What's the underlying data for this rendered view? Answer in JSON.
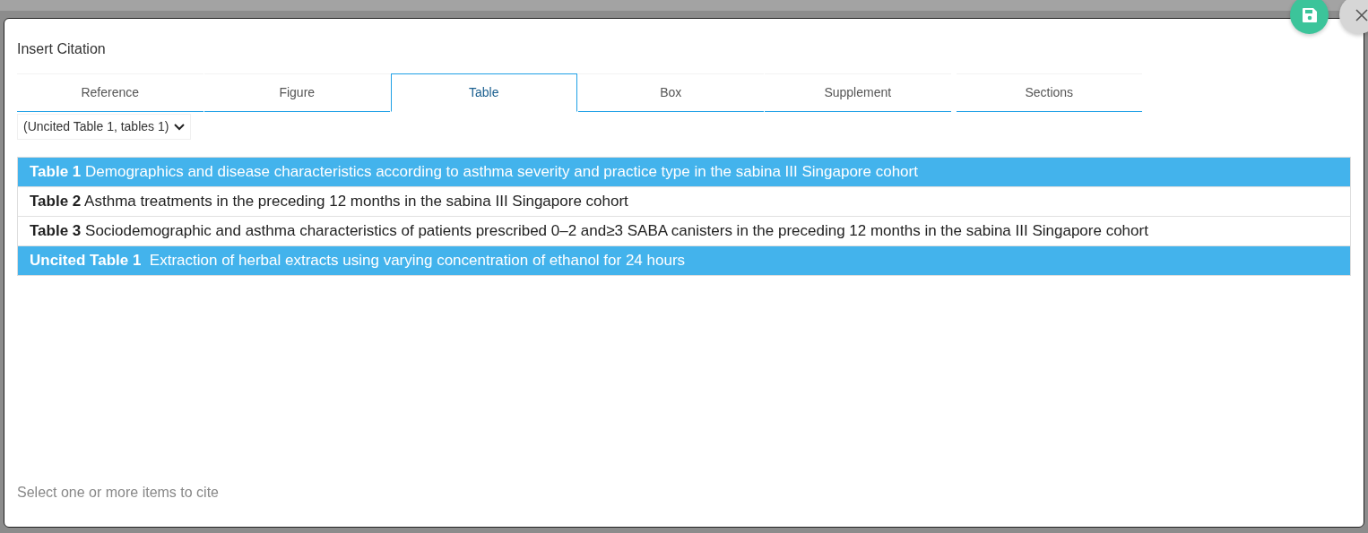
{
  "dialog": {
    "title": "Insert Citation",
    "tabs": [
      {
        "label": "Reference",
        "selected": false
      },
      {
        "label": "Figure",
        "selected": false
      },
      {
        "label": "Table",
        "selected": true
      },
      {
        "label": "Box",
        "selected": false
      },
      {
        "label": "Supplement",
        "selected": false
      },
      {
        "label": "Sections",
        "selected": false
      }
    ],
    "filter": {
      "value": "(Uncited Table 1, tables 1)"
    },
    "items": [
      {
        "text": "**Table 1** Demographics and disease characteristics according to asthma severity and practice type in the sabina III Singapore cohort",
        "selected": true
      },
      {
        "text": "**Table 2** Asthma treatments in the preceding 12 months in the sabina III Singapore cohort",
        "selected": false
      },
      {
        "text": "**Table 3** Sociodemographic and asthma characteristics of patients prescribed 0–2 and≥3 SABA canisters in the preceding 12 months in the sabina III Singapore cohort",
        "selected": false
      },
      {
        "text": "**Uncited Table 1**  Extraction of herbal extracts using varying concentration of ethanol for 24 hours",
        "selected": true
      }
    ],
    "hint": "Select one or more items to cite"
  }
}
